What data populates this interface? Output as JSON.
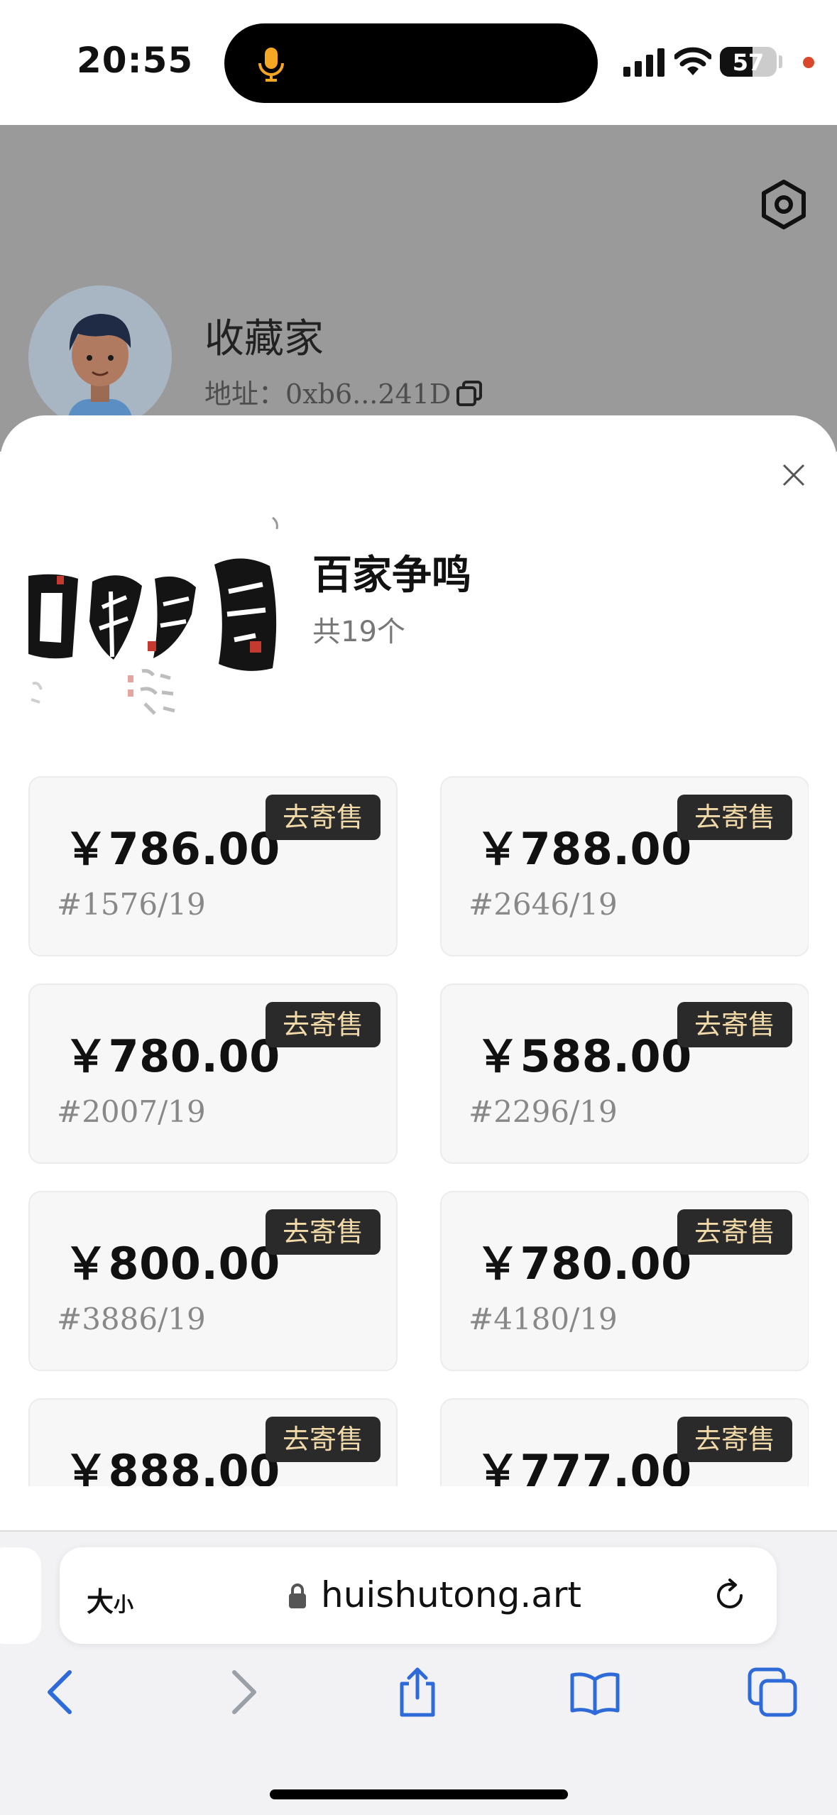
{
  "status_bar": {
    "time": "20:55",
    "battery": "57",
    "battery_level": 0.57
  },
  "profile": {
    "name": "收藏家",
    "address_label": "地址：",
    "address": "0xb6...241D"
  },
  "collection": {
    "title": "百家争鸣",
    "count": "共19个"
  },
  "items": [
    {
      "price": "￥786.00",
      "serial": "#1576/19",
      "action": "去寄售"
    },
    {
      "price": "￥788.00",
      "serial": "#2646/19",
      "action": "去寄售"
    },
    {
      "price": "￥780.00",
      "serial": "#2007/19",
      "action": "去寄售"
    },
    {
      "price": "￥588.00",
      "serial": "#2296/19",
      "action": "去寄售"
    },
    {
      "price": "￥800.00",
      "serial": "#3886/19",
      "action": "去寄售"
    },
    {
      "price": "￥780.00",
      "serial": "#4180/19",
      "action": "去寄售"
    },
    {
      "price": "￥888.00",
      "serial": "",
      "action": "去寄售"
    },
    {
      "price": "￥777.00",
      "serial": "",
      "action": "去寄售"
    }
  ],
  "browser": {
    "text_size": "大",
    "text_size_small": "小",
    "url": "huishutong.art"
  },
  "colors": {
    "consign_bg": "#2a2a2a",
    "consign_text": "#f1d9a8",
    "nav_blue": "#2f6bd8"
  }
}
